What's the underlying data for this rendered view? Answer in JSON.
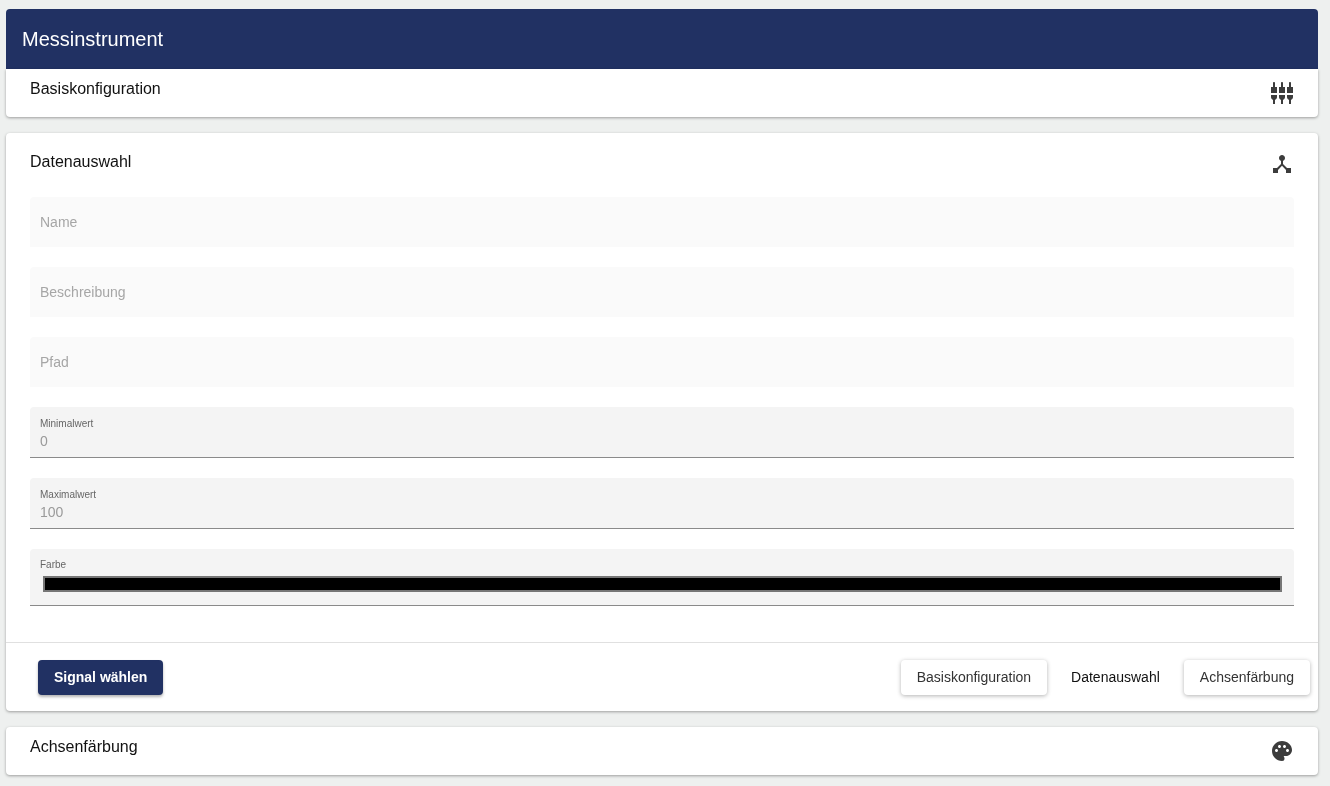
{
  "app_bar": {
    "title": "Messinstrument"
  },
  "panels": [
    {
      "title": "Basiskonfiguration",
      "expanded": false
    },
    {
      "title": "Datenauswahl",
      "expanded": true,
      "fields": [
        {
          "kind": "text",
          "placeholder": "Name",
          "disabled": true
        },
        {
          "kind": "text",
          "placeholder": "Beschreibung",
          "disabled": true
        },
        {
          "kind": "text",
          "placeholder": "Pfad",
          "disabled": true
        },
        {
          "kind": "text",
          "label": "Minimalwert",
          "value": "0",
          "disabled": false
        },
        {
          "kind": "text",
          "label": "Maximalwert",
          "value": "100",
          "disabled": false
        },
        {
          "kind": "color",
          "label": "Farbe",
          "color": "#000000",
          "disabled": false
        }
      ],
      "primary_action": {
        "label": "Signal wählen"
      },
      "steps": [
        {
          "label": "Basiskonfiguration",
          "selected": false
        },
        {
          "label": "Datenauswahl",
          "selected": true
        },
        {
          "label": "Achsenfärbung",
          "selected": false
        }
      ]
    },
    {
      "title": "Achsenfärbung",
      "expanded": false
    }
  ]
}
